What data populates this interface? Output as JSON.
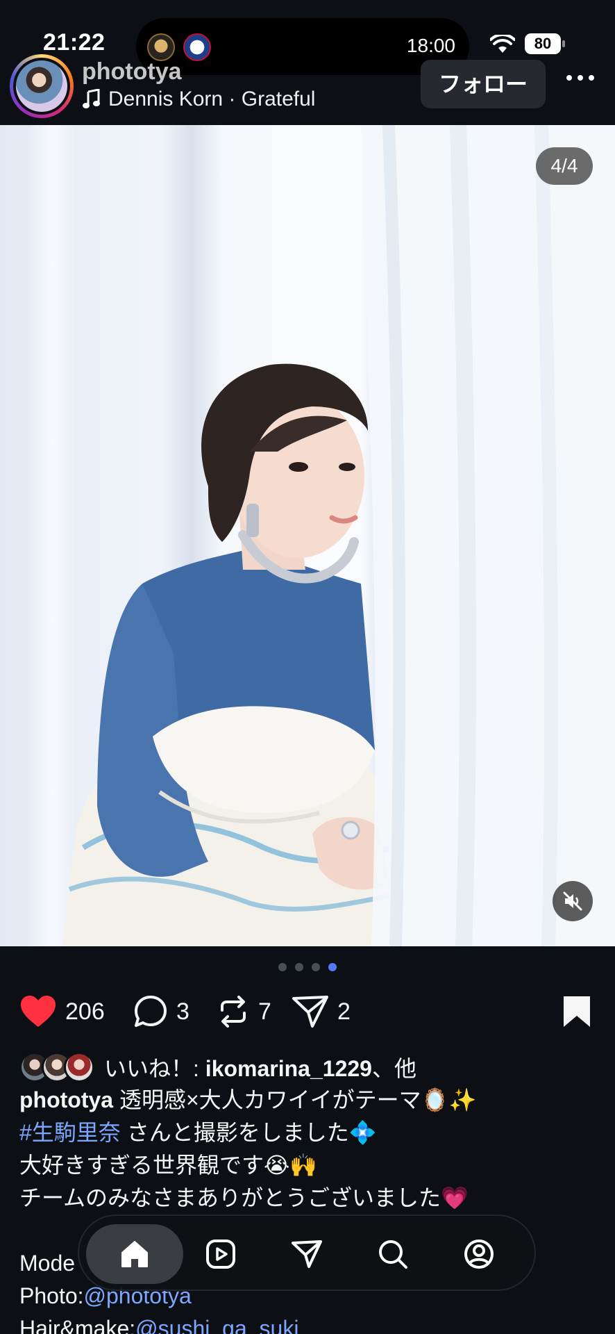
{
  "status_bar": {
    "time": "21:22",
    "live_activity_time": "18:00",
    "battery": "80"
  },
  "post": {
    "username": "phototya",
    "music": "Dennis Korn · Grateful",
    "follow_label": "フォロー",
    "photo_counter": "4/4",
    "carousel": {
      "total": 4,
      "current": 4
    }
  },
  "actions": {
    "likes": "206",
    "comments": "3",
    "reposts": "7",
    "shares": "2",
    "liked": true
  },
  "caption": {
    "liked_by_prefix": "いいね！: ",
    "liked_by_user": "ikomarina_1229",
    "liked_by_suffix": "、他",
    "author": "phototya",
    "line1": " 透明感×大人カワイイがテーマ",
    "line1_emoji": "🪞✨",
    "hashtag": "#生駒里奈",
    "line2": " さんと撮影をしました",
    "line2_emoji": "💠",
    "line3": "大好きすぎる世界観です",
    "line3_emoji": "😭🙌",
    "line4": "チームのみなさまありがとうございました",
    "line4_emoji": "💗",
    "model_label": "Mode",
    "photo_label": "Photo:",
    "photo_link": "@phototya",
    "hair_label": "Hair&make:",
    "hair_link": "@sushi_ga_suki"
  },
  "nav": {
    "items": [
      "home-icon",
      "reels-icon",
      "send-icon",
      "search-icon",
      "profile-icon"
    ],
    "active": "home-icon"
  },
  "colors": {
    "background": "#0c1014",
    "like_red": "#ff3040",
    "link_blue": "#7ea6ff",
    "dot_active": "#4f7cff"
  }
}
